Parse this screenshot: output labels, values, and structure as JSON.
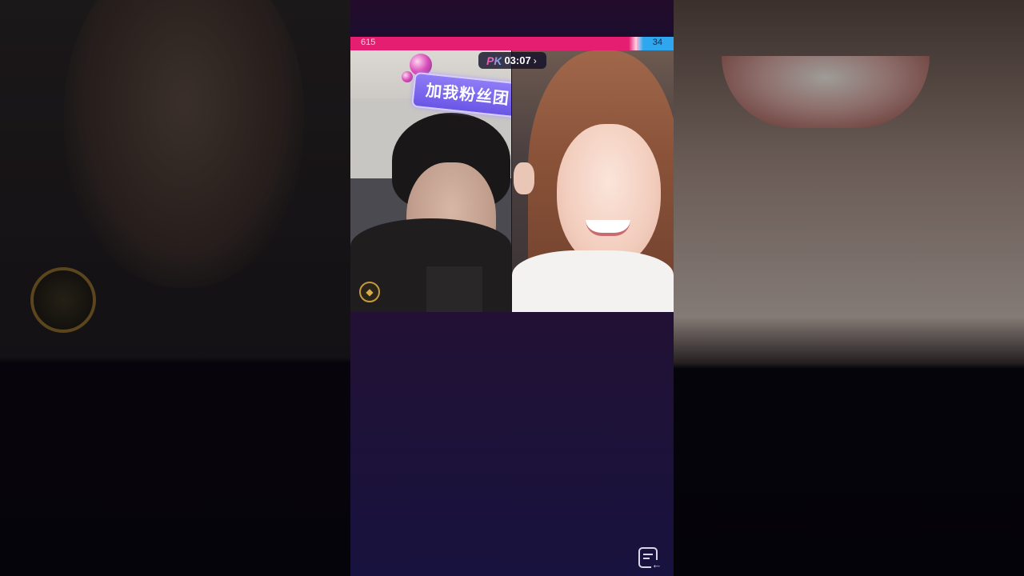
{
  "pk_battle": {
    "left_score": "615",
    "right_score": "34",
    "left_share": 0.948,
    "timer_label": "PK",
    "timer_value": "03:07",
    "chevron": "›",
    "left_color": "#e51e72",
    "right_color": "#2ea7ef"
  },
  "left_stream": {
    "sign_text": "加我粉丝团",
    "badge_icon": "fan-badge-icon"
  },
  "footer": {
    "chat_icon": "chat-return-icon"
  }
}
